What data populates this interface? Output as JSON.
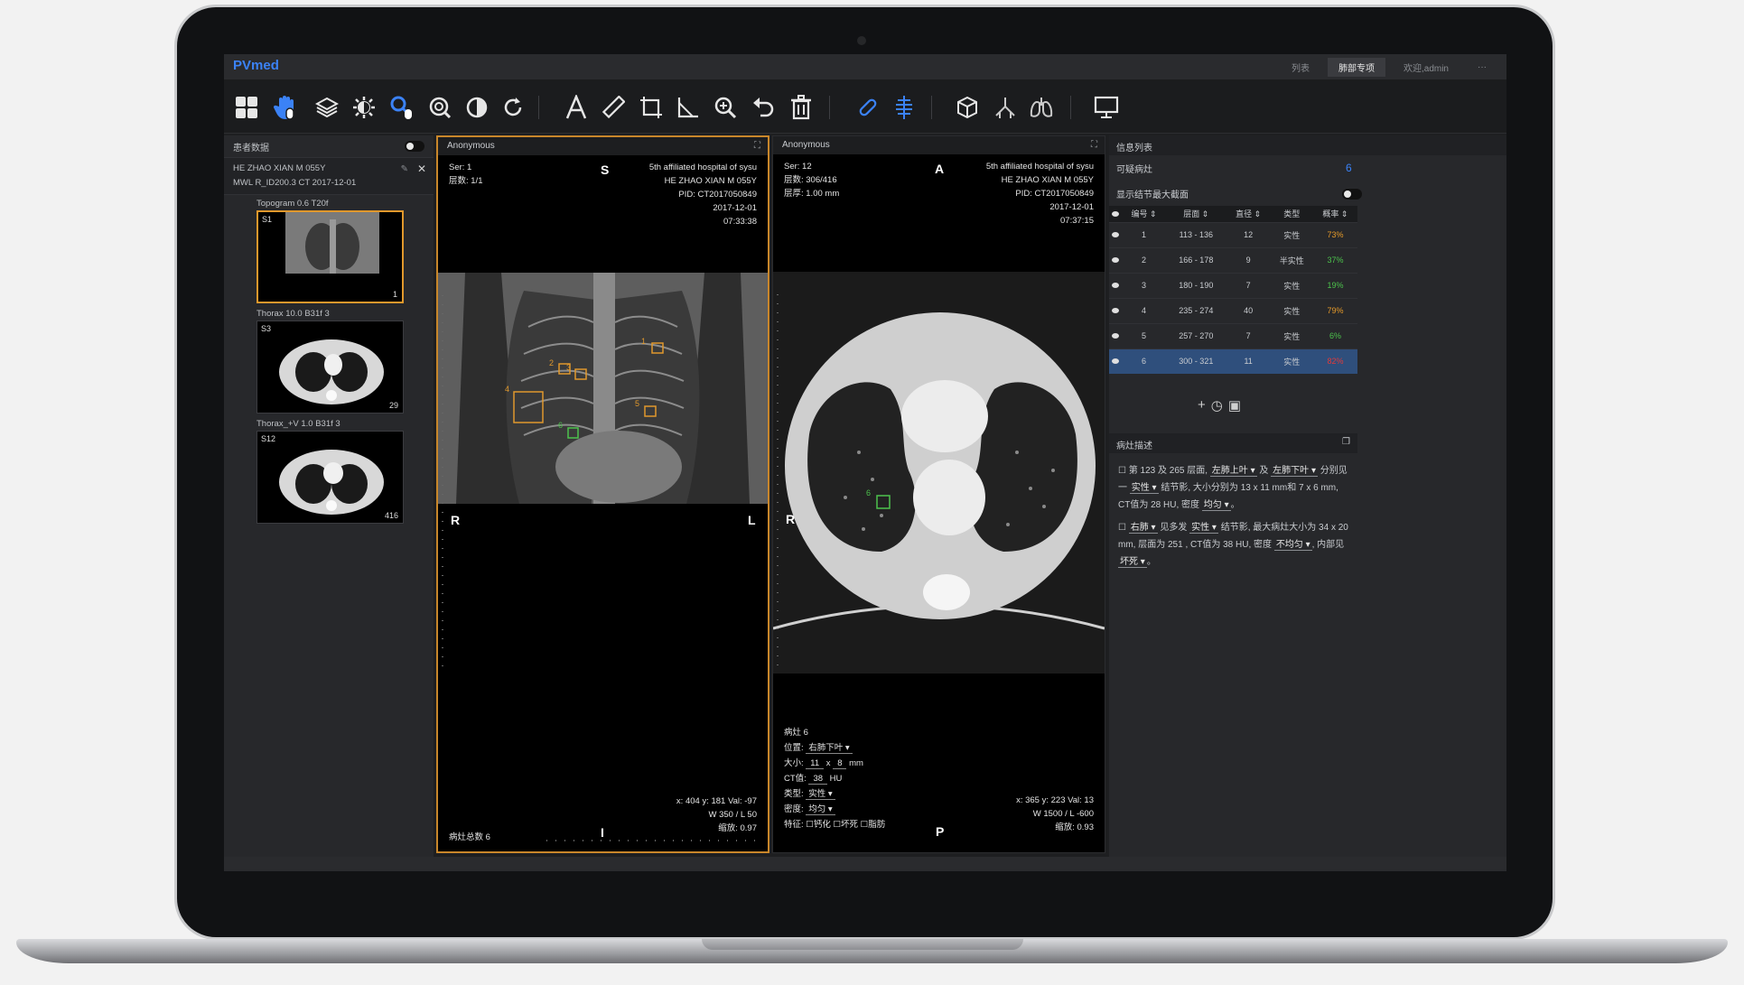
{
  "app": {
    "logo": "PVmed"
  },
  "menubar": {
    "list_label": "列表",
    "tab_active": "肺部专项",
    "user_label": "欢迎,admin",
    "more": "···"
  },
  "toolbar": {
    "tools": [
      {
        "name": "grid-layout-icon",
        "glyph": "▦"
      },
      {
        "name": "hand-pan-icon",
        "glyph": "✋"
      },
      {
        "name": "layers-icon",
        "glyph": "≋"
      },
      {
        "name": "brightness-icon",
        "glyph": "✹"
      },
      {
        "name": "magnifier-cursor-icon",
        "glyph": "⌕"
      },
      {
        "name": "zoom-region-icon",
        "glyph": "⊚"
      },
      {
        "name": "contrast-icon",
        "glyph": "◐"
      },
      {
        "name": "rotate-icon",
        "glyph": "↻"
      },
      {
        "name": "text-annotation-icon",
        "glyph": "A"
      },
      {
        "name": "ruler-icon",
        "glyph": "✎"
      },
      {
        "name": "rectangle-roi-icon",
        "glyph": "⬚"
      },
      {
        "name": "angle-icon",
        "glyph": "◺"
      },
      {
        "name": "zoom-in-icon",
        "glyph": "⊕"
      },
      {
        "name": "undo-icon",
        "glyph": "↶"
      },
      {
        "name": "trash-icon",
        "glyph": "🗑"
      },
      {
        "name": "link-icon",
        "glyph": "⚯"
      },
      {
        "name": "spine-icon",
        "glyph": "⋮"
      },
      {
        "name": "cube-3d-icon",
        "glyph": "❒"
      },
      {
        "name": "bronchi-icon",
        "glyph": "⋔"
      },
      {
        "name": "lungs-icon",
        "glyph": "♺"
      },
      {
        "name": "monitor-icon",
        "glyph": "▭"
      }
    ]
  },
  "left_panel": {
    "title": "患者数据",
    "patient_line1": "HE ZHAO XIAN   M   055Y",
    "patient_line2": "MWL R_ID200.3   CT   2017-12-01",
    "series": [
      {
        "label": "Topogram 0.6 T20f",
        "tl": "S1",
        "count": "1"
      },
      {
        "label": "Thorax 10.0 B31f 3",
        "tl": "S3",
        "count": "29"
      },
      {
        "label": "Thorax_+V 1.0 B31f 3",
        "tl": "S12",
        "count": "416"
      }
    ]
  },
  "viewport1": {
    "title": "Anonymous",
    "ser": "Ser: 1",
    "layer": "层数: 1/1",
    "hospital": "5th affiliated hospital of sysu",
    "patient": "HE ZHAO XIAN M 055Y",
    "pid": "PID: CT2017050849",
    "date": "2017-12-01",
    "time": "07:33:38",
    "ori_top": "S",
    "ori_left": "R",
    "ori_right": "L",
    "ori_bottom": "I",
    "coords": "x: 404 y: 181 Val: -97",
    "wl": "W 350 / L 50",
    "zoom": "缩放: 0.97",
    "nodule_total": "病灶总数 6",
    "markers": [
      "1",
      "2",
      "3",
      "4",
      "5",
      "6"
    ]
  },
  "viewport2": {
    "title": "Anonymous",
    "ser": "Ser: 12",
    "layer": "层数: 306/416",
    "thickness": "层厚: 1.00 mm",
    "hospital": "5th affiliated hospital of sysu",
    "patient": "HE ZHAO XIAN M 055Y",
    "pid": "PID: CT2017050849",
    "date": "2017-12-01",
    "time": "07:37:15",
    "ori_top": "A",
    "ori_left": "R",
    "ori_bottom": "P",
    "coords": "x: 365 y: 223 Val: 13",
    "wl": "W 1500 / L -600",
    "zoom": "缩放: 0.93",
    "marker": "6",
    "nodule": {
      "title": "病灶 6",
      "position_label": "位置:",
      "position_value": "右肺下叶 ▾",
      "size_label": "大小:",
      "size_a": "11",
      "size_x": "x",
      "size_b": "8",
      "size_unit": "mm",
      "ct_label": "CT值:",
      "ct_value": "38",
      "ct_unit": "HU",
      "type_label": "类型:",
      "type_value": "实性 ▾",
      "density_label": "密度:",
      "density_value": "均匀 ▾",
      "feature_label": "特征:",
      "features": [
        "钙化",
        "坏死",
        "脂肪"
      ]
    }
  },
  "right_panel": {
    "info_title": "信息列表",
    "suspect_label": "可疑病灶",
    "suspect_count": "6",
    "show_largest_label": "显示结节最大截面",
    "table_headers": [
      "编号",
      "层面",
      "直径",
      "类型",
      "概率"
    ],
    "rows": [
      {
        "id": "1",
        "layer": "113 - 136",
        "d": "12",
        "type": "实性",
        "prob": "73%",
        "color": "#e59a2a"
      },
      {
        "id": "2",
        "layer": "166 - 178",
        "d": "9",
        "type": "半实性",
        "prob": "37%",
        "color": "#4cc24c"
      },
      {
        "id": "3",
        "layer": "180 - 190",
        "d": "7",
        "type": "实性",
        "prob": "19%",
        "color": "#4cc24c"
      },
      {
        "id": "4",
        "layer": "235 - 274",
        "d": "40",
        "type": "实性",
        "prob": "79%",
        "color": "#e59a2a"
      },
      {
        "id": "5",
        "layer": "257 - 270",
        "d": "7",
        "type": "实性",
        "prob": "6%",
        "color": "#4cc24c"
      },
      {
        "id": "6",
        "layer": "300 - 321",
        "d": "11",
        "type": "实性",
        "prob": "82%",
        "color": "#e23a3a"
      }
    ],
    "desc_title": "病灶描述",
    "desc1": {
      "p1": "第 123 及 265 层面,",
      "d1": "左肺上叶 ▾",
      "p2": "及",
      "d2": "左肺下叶 ▾",
      "p3": "分别见一",
      "d3": "实性 ▾",
      "p4": "结节影, 大小分别为 13 x 11 mm和 7 x 6 mm, CT值为 28 HU, 密度",
      "d4": "均匀 ▾",
      "p5": "。"
    },
    "desc2": {
      "d1": "右肺 ▾",
      "p1": "见多发",
      "d2": "实性 ▾",
      "p2": "结节影, 最大病灶大小为 34 x 20 mm, 层面为 251 , CT值为 38 HU, 密度",
      "d3": "不均匀 ▾",
      "p3": ", 内部见",
      "d4": "坏死 ▾",
      "p4": "。"
    }
  }
}
